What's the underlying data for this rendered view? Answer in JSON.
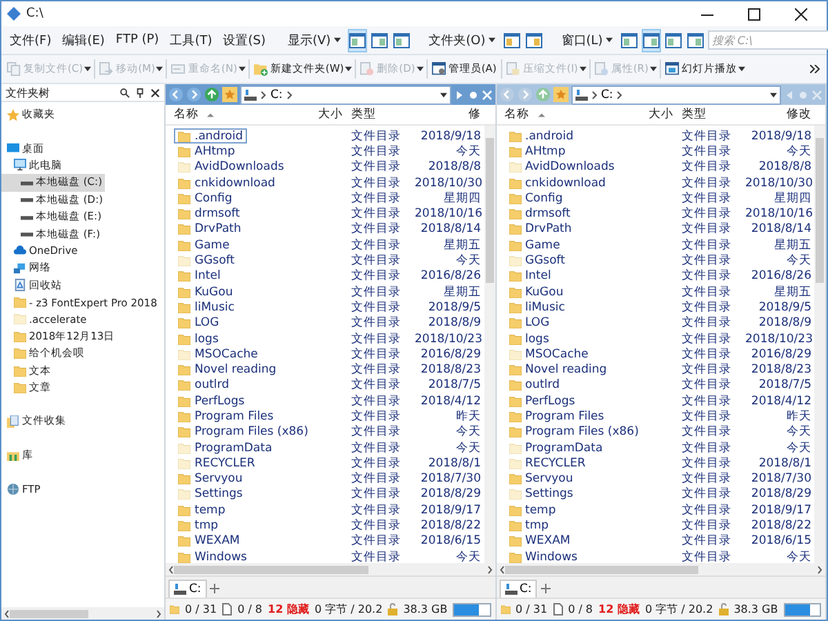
{
  "window": {
    "title": "C:\\"
  },
  "menu": [
    "文件(F)",
    "编辑(E)",
    "FTP (P)",
    "工具(T)",
    "设置(S)"
  ],
  "view_groups": [
    {
      "label": "显示(V)",
      "buttons": [
        {
          "selected": true
        },
        {
          "selected": false
        },
        {
          "selected": false
        }
      ]
    },
    {
      "label": "文件夹(O)",
      "buttons": [
        {
          "selected": false
        },
        {
          "selected": false
        }
      ]
    },
    {
      "label": "窗口(L)",
      "buttons": [
        {
          "selected": false
        },
        {
          "selected": true
        },
        {
          "selected": false
        },
        {
          "selected": false
        }
      ]
    }
  ],
  "search": {
    "placeholder": "搜索 C:\\"
  },
  "actions": [
    {
      "kind": "copy",
      "label": "复制文件(C)",
      "disabled": true,
      "dropdown": true
    },
    {
      "kind": "move",
      "label": "移动(M)",
      "disabled": true,
      "dropdown": true
    },
    {
      "kind": "rename",
      "label": "重命名(N)",
      "disabled": true,
      "dropdown": true
    },
    {
      "kind": "newfolder",
      "label": "新建文件夹(W)",
      "disabled": false,
      "dropdown": true
    },
    {
      "kind": "delete",
      "label": "删除(D)",
      "disabled": true,
      "dropdown": true
    },
    {
      "kind": "admin",
      "label": "管理员(A)",
      "disabled": false,
      "dropdown": false
    },
    {
      "kind": "zip",
      "label": "压缩文件(I)",
      "disabled": true,
      "dropdown": true
    },
    {
      "kind": "props",
      "label": "属性(R)",
      "disabled": true,
      "dropdown": true
    },
    {
      "kind": "slideshow",
      "label": "幻灯片播放",
      "disabled": false,
      "dropdown": true
    }
  ],
  "tree": {
    "title": "文件夹树",
    "items": [
      {
        "kind": "star",
        "label": "收藏夹",
        "selected": false
      },
      {
        "kind": "desktop",
        "label": "桌面",
        "selected": false,
        "children": [
          {
            "kind": "pc",
            "label": "此电脑",
            "selected": false,
            "children": [
              {
                "kind": "drive",
                "label": "本地磁盘 (C:)",
                "selected": true
              },
              {
                "kind": "drive",
                "label": "本地磁盘 (D:)",
                "selected": false
              },
              {
                "kind": "drive",
                "label": "本地磁盘 (E:)",
                "selected": false
              },
              {
                "kind": "drive",
                "label": "本地磁盘 (F:)",
                "selected": false
              }
            ]
          },
          {
            "kind": "cloud",
            "label": "OneDrive",
            "selected": false
          },
          {
            "kind": "network",
            "label": "网络",
            "selected": false
          },
          {
            "kind": "recycle",
            "label": "回收站",
            "selected": false
          },
          {
            "kind": "folder",
            "label": "-  z3 FontExpert Pro 2018",
            "selected": false
          },
          {
            "kind": "hiddenfolder",
            "label": ".accelerate",
            "selected": false
          },
          {
            "kind": "folder",
            "label": "2018年12月13日",
            "selected": false
          },
          {
            "kind": "folder",
            "label": "给个机会呗",
            "selected": false
          },
          {
            "kind": "folder",
            "label": "文本",
            "selected": false
          },
          {
            "kind": "folder",
            "label": "文章",
            "selected": false
          }
        ]
      },
      {
        "kind": "collection",
        "label": "文件收集",
        "selected": false
      },
      {
        "kind": "library",
        "label": "库",
        "selected": false
      },
      {
        "kind": "ftp",
        "label": "FTP",
        "selected": false
      }
    ]
  },
  "panes": [
    {
      "active": true,
      "path": "C:",
      "columns": [
        "名称",
        "大小",
        "类型",
        "修"
      ],
      "rows": [
        {
          "name": ".android",
          "type": "文件目录",
          "date": "2018/9/18",
          "hidden": false,
          "focused": true
        },
        {
          "name": "AHtmp",
          "type": "文件目录",
          "date": "今天",
          "hidden": false,
          "focused": false
        },
        {
          "name": "AvidDownloads",
          "type": "文件目录",
          "date": "2018/8/8",
          "hidden": true,
          "focused": false
        },
        {
          "name": "cnkidownload",
          "type": "文件目录",
          "date": "2018/10/30",
          "hidden": false,
          "focused": false
        },
        {
          "name": "Config",
          "type": "文件目录",
          "date": "星期四",
          "hidden": false,
          "focused": false
        },
        {
          "name": "drmsoft",
          "type": "文件目录",
          "date": "2018/10/16",
          "hidden": false,
          "focused": false
        },
        {
          "name": "DrvPath",
          "type": "文件目录",
          "date": "2018/8/14",
          "hidden": false,
          "focused": false
        },
        {
          "name": "Game",
          "type": "文件目录",
          "date": "星期五",
          "hidden": false,
          "focused": false
        },
        {
          "name": "GGsoft",
          "type": "文件目录",
          "date": "今天",
          "hidden": true,
          "focused": false
        },
        {
          "name": "Intel",
          "type": "文件目录",
          "date": "2016/8/26",
          "hidden": false,
          "focused": false
        },
        {
          "name": "KuGou",
          "type": "文件目录",
          "date": "星期五",
          "hidden": false,
          "focused": false
        },
        {
          "name": "liMusic",
          "type": "文件目录",
          "date": "2018/9/5",
          "hidden": false,
          "focused": false
        },
        {
          "name": "LOG",
          "type": "文件目录",
          "date": "2018/8/9",
          "hidden": false,
          "focused": false
        },
        {
          "name": "logs",
          "type": "文件目录",
          "date": "2018/10/23",
          "hidden": false,
          "focused": false
        },
        {
          "name": "MSOCache",
          "type": "文件目录",
          "date": "2016/8/29",
          "hidden": true,
          "focused": false
        },
        {
          "name": "Novel reading",
          "type": "文件目录",
          "date": "2018/8/23",
          "hidden": false,
          "focused": false
        },
        {
          "name": "outlrd",
          "type": "文件目录",
          "date": "2018/7/5",
          "hidden": false,
          "focused": false
        },
        {
          "name": "PerfLogs",
          "type": "文件目录",
          "date": "2018/4/12",
          "hidden": false,
          "focused": false
        },
        {
          "name": "Program Files",
          "type": "文件目录",
          "date": "昨天",
          "hidden": false,
          "focused": false
        },
        {
          "name": "Program Files (x86)",
          "type": "文件目录",
          "date": "今天",
          "hidden": false,
          "focused": false
        },
        {
          "name": "ProgramData",
          "type": "文件目录",
          "date": "今天",
          "hidden": true,
          "focused": false
        },
        {
          "name": "RECYCLER",
          "type": "文件目录",
          "date": "2018/8/1",
          "hidden": true,
          "focused": false
        },
        {
          "name": "Servyou",
          "type": "文件目录",
          "date": "2018/7/30",
          "hidden": false,
          "focused": false
        },
        {
          "name": "Settings",
          "type": "文件目录",
          "date": "2018/8/29",
          "hidden": true,
          "focused": false
        },
        {
          "name": "temp",
          "type": "文件目录",
          "date": "2018/9/17",
          "hidden": false,
          "focused": false
        },
        {
          "name": "tmp",
          "type": "文件目录",
          "date": "2018/8/22",
          "hidden": false,
          "focused": false
        },
        {
          "name": "WEXAM",
          "type": "文件目录",
          "date": "2018/6/15",
          "hidden": false,
          "focused": false
        },
        {
          "name": "Windows",
          "type": "文件目录",
          "date": "今天",
          "hidden": false,
          "focused": false
        }
      ],
      "tab": "C:",
      "status": {
        "folders": "0 / 31",
        "files": "0 / 8",
        "hidden": "12 隐藏",
        "bytes": "0 字节 / 20.2",
        "free": "38.3 GB",
        "level": 0.72
      }
    },
    {
      "active": false,
      "path": "C:",
      "columns": [
        "名称",
        "大小",
        "类型",
        "修改"
      ],
      "rows": [
        {
          "name": ".android",
          "type": "文件目录",
          "date": "2018/9/18",
          "hidden": false,
          "focused": false
        },
        {
          "name": "AHtmp",
          "type": "文件目录",
          "date": "今天",
          "hidden": false,
          "focused": false
        },
        {
          "name": "AvidDownloads",
          "type": "文件目录",
          "date": "2018/8/8",
          "hidden": true,
          "focused": false
        },
        {
          "name": "cnkidownload",
          "type": "文件目录",
          "date": "2018/10/30",
          "hidden": false,
          "focused": false
        },
        {
          "name": "Config",
          "type": "文件目录",
          "date": "星期四",
          "hidden": false,
          "focused": false
        },
        {
          "name": "drmsoft",
          "type": "文件目录",
          "date": "2018/10/16",
          "hidden": false,
          "focused": false
        },
        {
          "name": "DrvPath",
          "type": "文件目录",
          "date": "2018/8/14",
          "hidden": false,
          "focused": false
        },
        {
          "name": "Game",
          "type": "文件目录",
          "date": "星期五",
          "hidden": false,
          "focused": false
        },
        {
          "name": "GGsoft",
          "type": "文件目录",
          "date": "今天",
          "hidden": true,
          "focused": false
        },
        {
          "name": "Intel",
          "type": "文件目录",
          "date": "2016/8/26",
          "hidden": false,
          "focused": false
        },
        {
          "name": "KuGou",
          "type": "文件目录",
          "date": "星期五",
          "hidden": false,
          "focused": false
        },
        {
          "name": "liMusic",
          "type": "文件目录",
          "date": "2018/9/5",
          "hidden": false,
          "focused": false
        },
        {
          "name": "LOG",
          "type": "文件目录",
          "date": "2018/8/9",
          "hidden": false,
          "focused": false
        },
        {
          "name": "logs",
          "type": "文件目录",
          "date": "2018/10/23",
          "hidden": false,
          "focused": false
        },
        {
          "name": "MSOCache",
          "type": "文件目录",
          "date": "2016/8/29",
          "hidden": true,
          "focused": false
        },
        {
          "name": "Novel reading",
          "type": "文件目录",
          "date": "2018/8/23",
          "hidden": false,
          "focused": false
        },
        {
          "name": "outlrd",
          "type": "文件目录",
          "date": "2018/7/5",
          "hidden": false,
          "focused": false
        },
        {
          "name": "PerfLogs",
          "type": "文件目录",
          "date": "2018/4/12",
          "hidden": false,
          "focused": false
        },
        {
          "name": "Program Files",
          "type": "文件目录",
          "date": "昨天",
          "hidden": false,
          "focused": false
        },
        {
          "name": "Program Files (x86)",
          "type": "文件目录",
          "date": "今天",
          "hidden": false,
          "focused": false
        },
        {
          "name": "ProgramData",
          "type": "文件目录",
          "date": "今天",
          "hidden": true,
          "focused": false
        },
        {
          "name": "RECYCLER",
          "type": "文件目录",
          "date": "2018/8/1",
          "hidden": true,
          "focused": false
        },
        {
          "name": "Servyou",
          "type": "文件目录",
          "date": "2018/7/30",
          "hidden": false,
          "focused": false
        },
        {
          "name": "Settings",
          "type": "文件目录",
          "date": "2018/8/29",
          "hidden": true,
          "focused": false
        },
        {
          "name": "temp",
          "type": "文件目录",
          "date": "2018/9/17",
          "hidden": false,
          "focused": false
        },
        {
          "name": "tmp",
          "type": "文件目录",
          "date": "2018/8/22",
          "hidden": false,
          "focused": false
        },
        {
          "name": "WEXAM",
          "type": "文件目录",
          "date": "2018/6/15",
          "hidden": false,
          "focused": false
        },
        {
          "name": "Windows",
          "type": "文件目录",
          "date": "今天",
          "hidden": false,
          "focused": false
        }
      ],
      "tab": "C:",
      "status": {
        "folders": "0 / 31",
        "files": "0 / 8",
        "hidden": "12 隐藏",
        "bytes": "0 字节 / 20.2",
        "free": "38.3 GB",
        "level": 0.72
      }
    }
  ]
}
